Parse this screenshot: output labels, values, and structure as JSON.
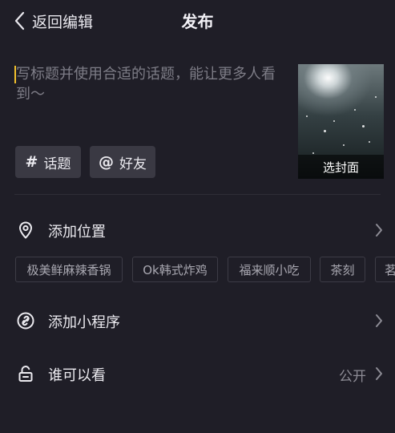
{
  "header": {
    "back_label": "返回编辑",
    "title": "发布"
  },
  "caption": {
    "placeholder": "写标题并使用合适的话题，能让更多人看到～"
  },
  "cover": {
    "label": "选封面"
  },
  "chips": {
    "topic_symbol": "#",
    "topic_label": "话题",
    "friend_symbol": "@",
    "friend_label": "好友"
  },
  "location": {
    "label": "添加位置",
    "icon": "location-pin-icon",
    "tags": [
      "极美鲜麻辣香锅",
      "Ok韩式炸鸡",
      "福来顺小吃",
      "茶刻",
      "茗"
    ]
  },
  "miniprogram": {
    "label": "添加小程序",
    "icon": "link-icon"
  },
  "privacy": {
    "label": "谁可以看",
    "value": "公开",
    "icon": "unlock-icon"
  },
  "colors": {
    "background": "#1f1e27",
    "chip_background": "#3a3943",
    "caret": "#f1c12c",
    "placeholder": "#7e7d87"
  }
}
